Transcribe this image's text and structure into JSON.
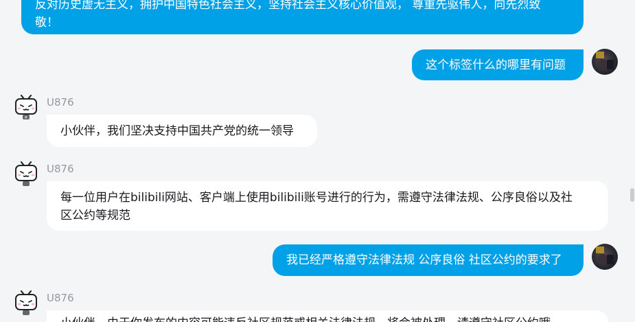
{
  "colors": {
    "outgoing": "#00a1e6",
    "incoming": "#ffffff",
    "background": "#f4f5f7",
    "sender_name": "#9499a0"
  },
  "messages": [
    {
      "from": "user",
      "text_line1": "反对历史虚无主义，拥护中国特色社会主义，坚持社会主义核心价值观， 尊重先驱伟人，向先烈致",
      "text_line2": "敬！"
    },
    {
      "from": "user",
      "text": "这个标签什么的哪里有问题"
    },
    {
      "from": "bot",
      "sender": "U876",
      "text": "小伙伴，我们坚决支持中国共产党的统一领导"
    },
    {
      "from": "bot",
      "sender": "U876",
      "text_line1": "每一位用户在bilibili网站、客户端上使用bilibili账号进行的行为，需遵守法律法规、公序良俗以及社",
      "text_line2": "区公约等规范"
    },
    {
      "from": "user",
      "text": "我已经严格遵守法律法规 公序良俗 社区公约的要求了"
    },
    {
      "from": "bot",
      "sender": "U876",
      "text": "小伙伴，由于你发布的内容可能违反社区规范或相关法律法规，将会被处理，请遵守社区公约哦"
    }
  ],
  "icons": {
    "bot": "bilibili-tv-mascot-icon",
    "user": "user-avatar-photo"
  }
}
